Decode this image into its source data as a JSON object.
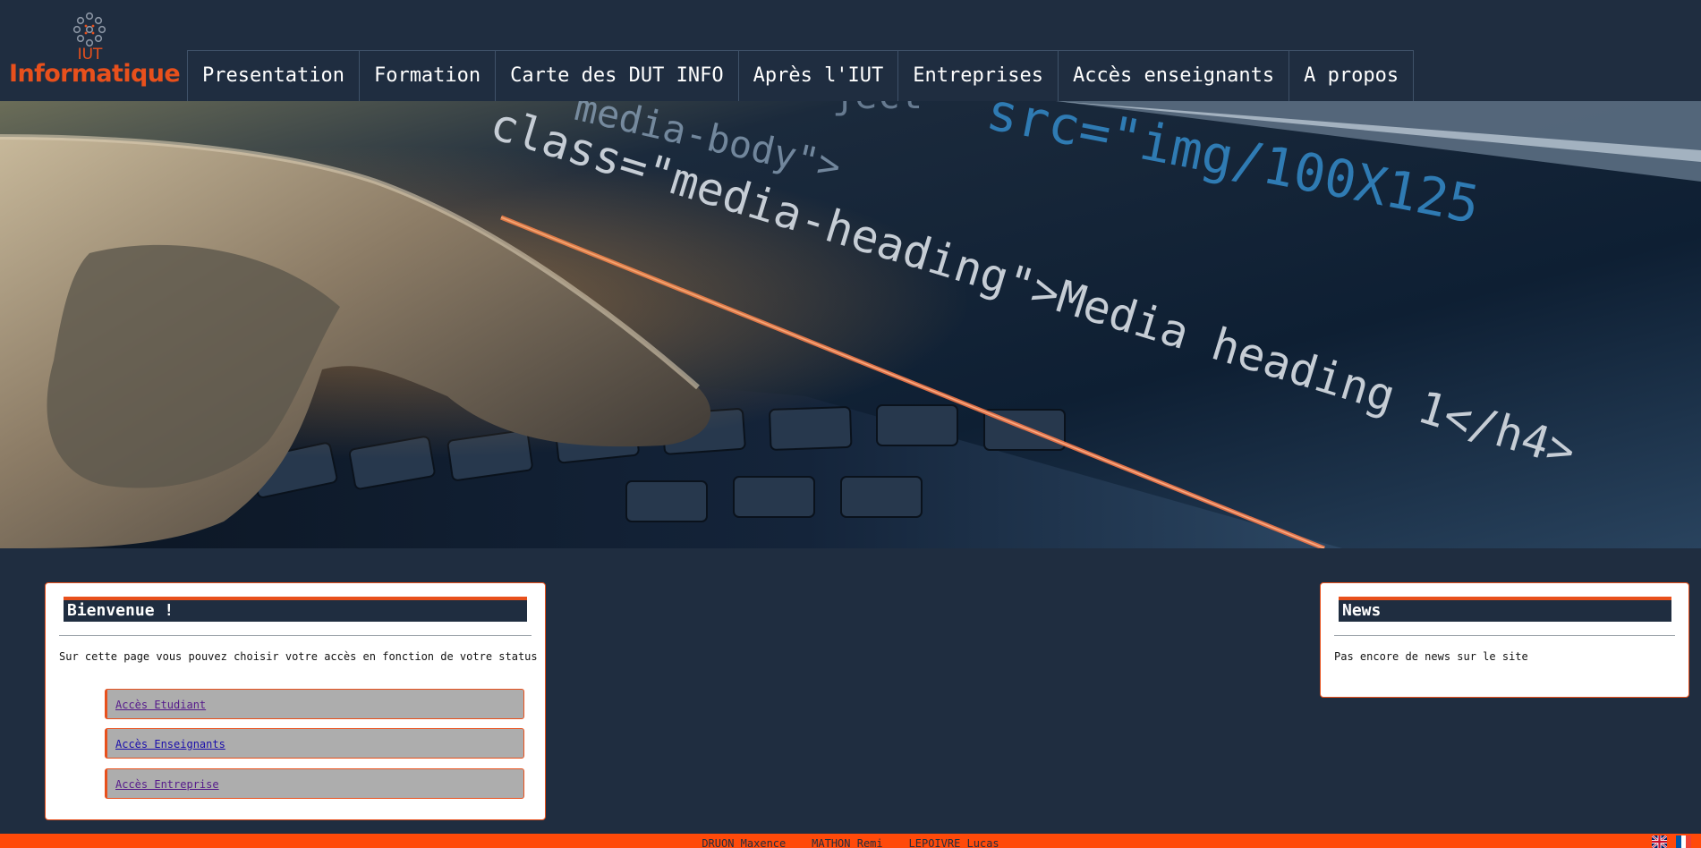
{
  "logo": {
    "top_text": "IUT",
    "word": "Informatique",
    "icon": "molecule-icon"
  },
  "nav": {
    "items": [
      {
        "label": "Presentation"
      },
      {
        "label": "Formation"
      },
      {
        "label": "Carte des DUT INFO"
      },
      {
        "label": "Après l'IUT"
      },
      {
        "label": "Entreprises"
      },
      {
        "label": "Accès enseignants"
      },
      {
        "label": "A propos"
      }
    ]
  },
  "hero": {
    "lines": [
      "media-body\">",
      "ject",
      "src=\"img/100X125",
      "class=\"media-heading\">Media heading 1</h4>"
    ]
  },
  "welcome": {
    "title": "Bienvenue !",
    "text": "Sur cette page vous pouvez choisir votre accès en fonction de votre status",
    "buttons": [
      {
        "label": "Accès Etudiant"
      },
      {
        "label": "Accès Enseignants"
      },
      {
        "label": "Accès Entreprise"
      }
    ]
  },
  "news": {
    "title": "News",
    "text": "Pas encore de news sur le site"
  },
  "footer": {
    "credits": "DRUON Maxence __ MATHON Remi __ LEPOIVRE Lucas",
    "flags": [
      "uk-flag-icon",
      "france-flag-icon"
    ]
  },
  "colors": {
    "background": "#1f2d40",
    "accent": "#e8501c",
    "footer": "#ff4a0a",
    "button_bg": "#adadad"
  }
}
